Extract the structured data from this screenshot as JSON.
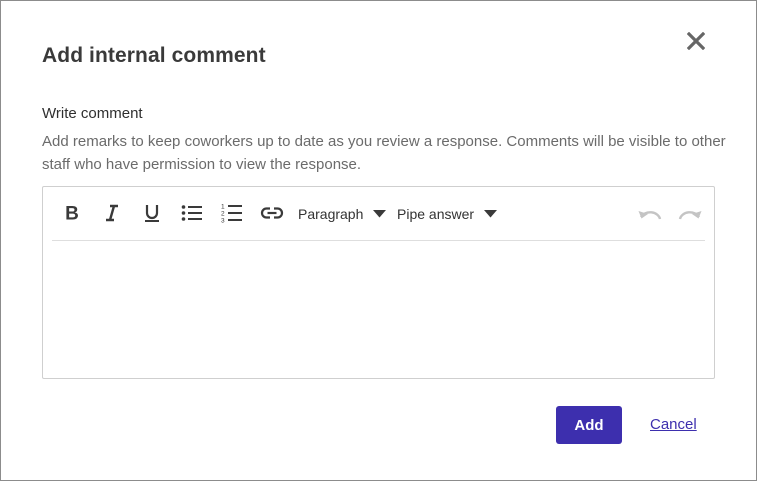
{
  "dialog": {
    "title": "Add internal comment",
    "close_icon": "close-icon"
  },
  "comment_field": {
    "label": "Write comment",
    "help": "Add remarks to keep coworkers up to date as you review a response. Comments will be visible to other staff who have permission to view the response.",
    "value": ""
  },
  "toolbar": {
    "icons": [
      "bold-icon",
      "italic-icon",
      "underline-icon",
      "bullet-list-icon",
      "numbered-list-icon",
      "link-icon",
      "undo-icon",
      "redo-icon"
    ],
    "paragraph_label": "Paragraph",
    "pipe_answer_label": "Pipe answer"
  },
  "actions": {
    "add_label": "Add",
    "cancel_label": "Cancel"
  },
  "colors": {
    "primary": "#3d2fae",
    "icon": "#3a3a3a",
    "icon_disabled": "#c4c4c4",
    "help_text": "#6b6b6b",
    "border": "#cfcfcf"
  }
}
